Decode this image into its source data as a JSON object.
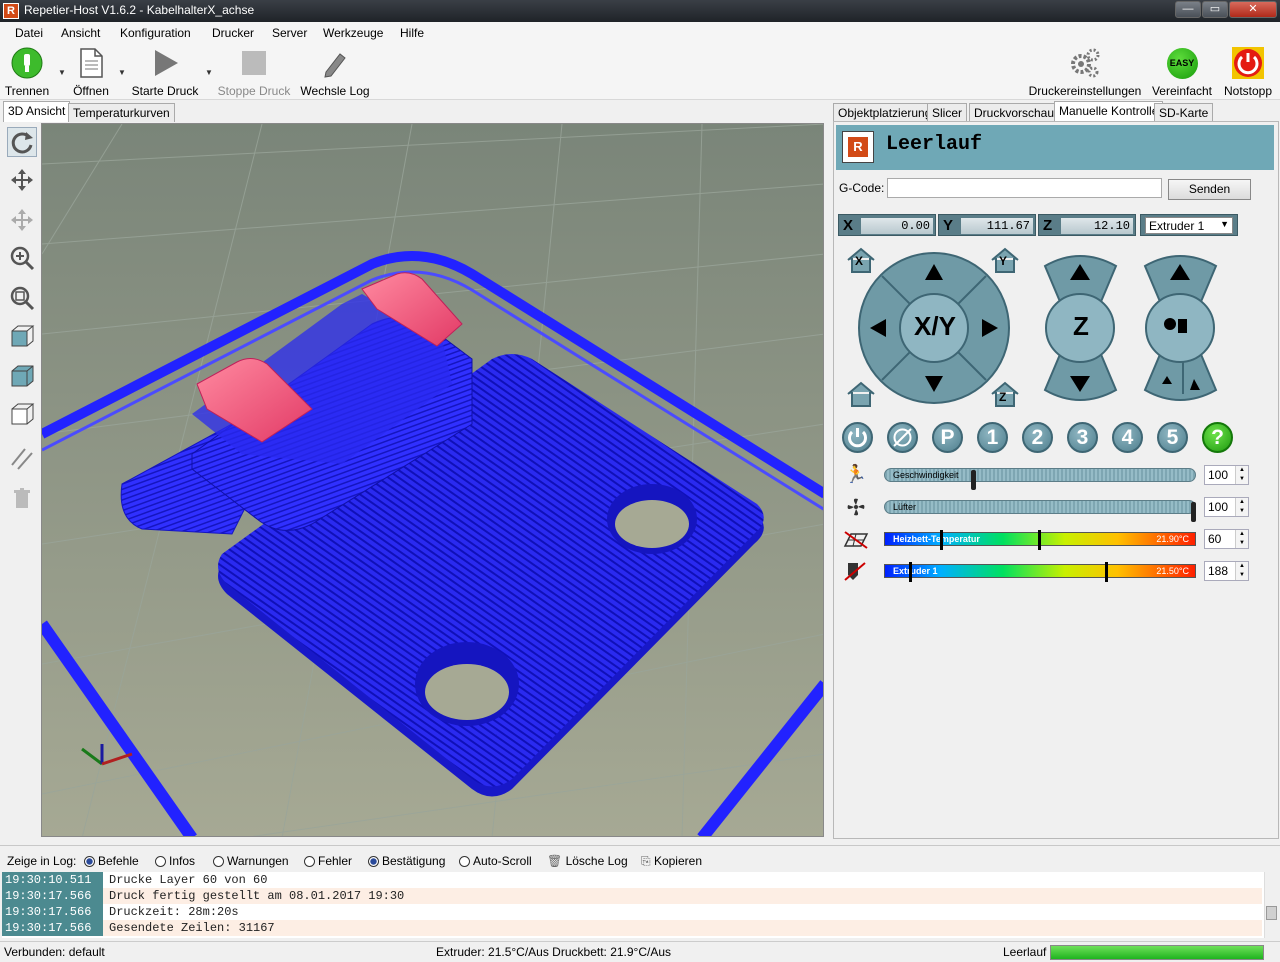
{
  "window": {
    "title": "Repetier-Host V1.6.2 - KabelhalterX_achse",
    "app_icon": "R"
  },
  "menu": [
    "Datei",
    "Ansicht",
    "Konfiguration",
    "Drucker",
    "Server",
    "Werkzeuge",
    "Hilfe"
  ],
  "toolbar": {
    "disconnect": "Trennen",
    "open": "Öffnen",
    "start": "Starte Druck",
    "stop": "Stoppe Druck",
    "log": "Wechsle Log",
    "printer_settings": "Druckereinstellungen",
    "easy": "Vereinfacht",
    "easy_badge": "EASY",
    "estop": "Notstopp"
  },
  "view_tabs": [
    "3D Ansicht",
    "Temperaturkurven"
  ],
  "panel_tabs": [
    "Objektplatzierung",
    "Slicer",
    "Druckvorschau",
    "Manuelle Kontrolle",
    "SD-Karte"
  ],
  "control": {
    "status": "Leerlauf",
    "status_logo": "R",
    "gcode_label": "G-Code:",
    "gcode_value": "",
    "send_label": "Senden",
    "x_label": "X",
    "x": "0.00",
    "y_label": "Y",
    "y": "111.67",
    "z_label": "Z",
    "z": "12.10",
    "extruder_select": "Extruder 1",
    "xy_label": "X/Y",
    "z_pad_label": "Z",
    "home_x": "X",
    "home_y": "Y",
    "home_z": "Z",
    "buttons": [
      "P",
      "1",
      "2",
      "3",
      "4",
      "5",
      "?"
    ]
  },
  "sliders": {
    "speed": {
      "label": "Geschwindigkeit",
      "value": "100",
      "level": 0.28
    },
    "fan": {
      "label": "Lüfter",
      "value": "100",
      "level": 1.0
    },
    "bed": {
      "label": "Heizbett-Temperatur",
      "current": "21.90°C",
      "target": "60",
      "current_level": 0.18,
      "target_level": 0.5
    },
    "extruder": {
      "label": "Extruder 1",
      "current": "21.50°C",
      "target": "188",
      "current_level": 0.08,
      "target_level": 0.72
    }
  },
  "logbar": {
    "label": "Zeige in Log:",
    "options": [
      "Befehle",
      "Infos",
      "Warnungen",
      "Fehler",
      "Bestätigung",
      "Auto-Scroll"
    ],
    "clear": "Lösche Log",
    "copy": "Kopieren"
  },
  "log": [
    {
      "time": "19:30:10.511",
      "msg": "Drucke Layer 60 von 60"
    },
    {
      "time": "19:30:17.566",
      "msg": "Druck fertig gestellt am 08.01.2017 19:30"
    },
    {
      "time": "19:30:17.566",
      "msg": "Druckzeit: 28m:20s"
    },
    {
      "time": "19:30:17.566",
      "msg": "Gesendete Zeilen: 31167"
    }
  ],
  "statusbar": {
    "connection": "Verbunden: default",
    "temps": "Extruder: 21.5°C/Aus Druckbett: 21.9°C/Aus",
    "state": "Leerlauf",
    "progress": 1.0
  },
  "colors": {
    "accent": "#6fa8b6",
    "model": "#2222ff",
    "model_top": "#ff5a7a",
    "grid_bg": "#7d8577",
    "ok_green": "#22c222"
  }
}
